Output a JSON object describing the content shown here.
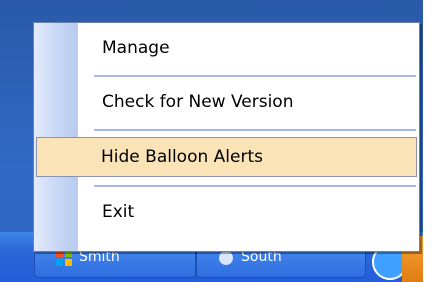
{
  "taskbar": {
    "buttons": [
      {
        "label": "Smith"
      },
      {
        "label": "South"
      }
    ]
  },
  "menu": {
    "items": [
      {
        "label": "Manage"
      },
      {
        "label": "Check for New Version"
      },
      {
        "label": "Hide Balloon Alerts",
        "highlighted": true
      },
      {
        "label": "Exit"
      }
    ]
  },
  "colors": {
    "desktop": "#3169c6",
    "taskbar": "#245edb",
    "menu_background": "#ffffff",
    "menu_highlight": "#fbe3b8",
    "menu_gutter": "#c7d7f5"
  },
  "icons": {
    "tray": "globe-icon",
    "start": "windows-flag-icon"
  }
}
